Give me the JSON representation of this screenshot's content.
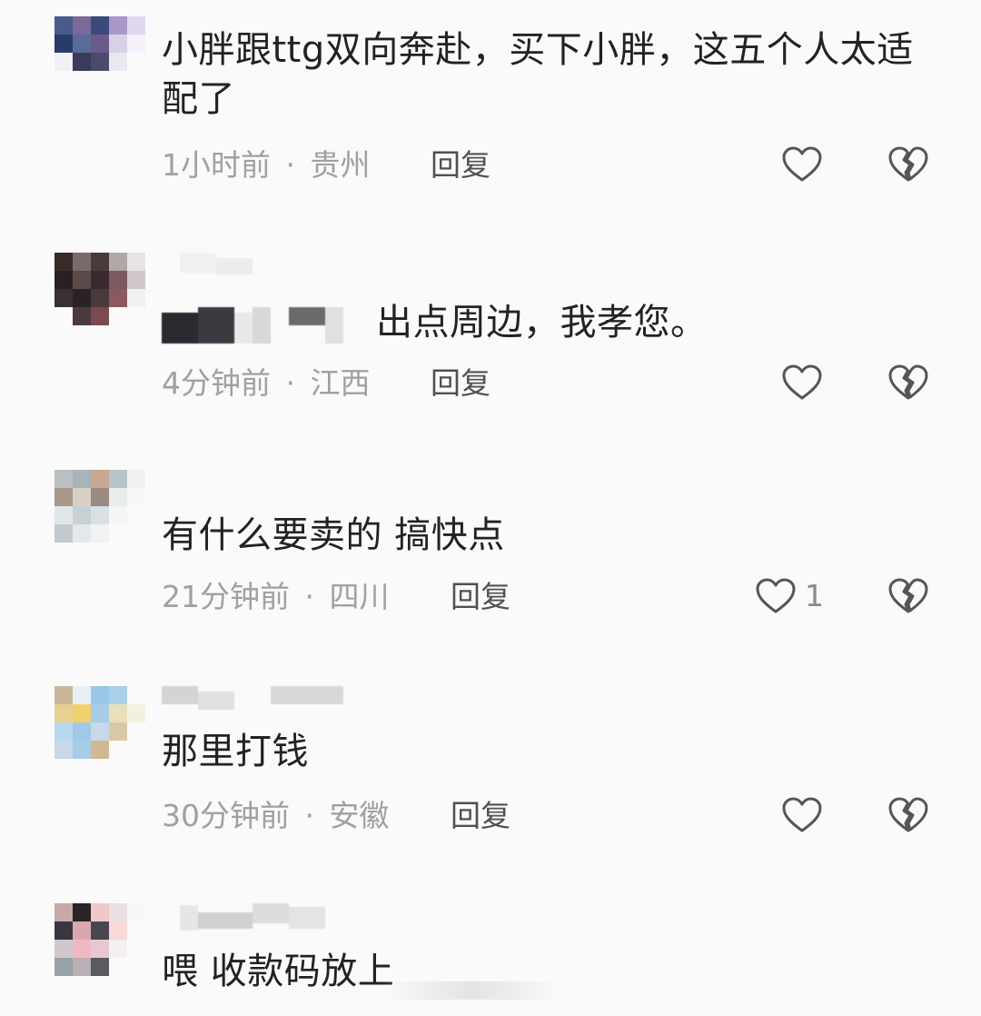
{
  "comments": [
    {
      "text": "小胖跟ttg双向奔赴，买下小胖，这五个人太适配了",
      "time": "1小时前",
      "location": "贵州",
      "reply_label": "回复",
      "likes": "",
      "avatar_colors": [
        "#4a5a8a",
        "#7a6a9a",
        "#3a4a7a",
        "#a898c8",
        "#e0d8f0",
        "#2a3a6a",
        "#5a6a9a",
        "#6a5a8a",
        "#d8d0e8",
        "#f5f0fa",
        "#f0f0f5",
        "#3a3a5a",
        "#4a4a6a",
        "#e8e8ee",
        "#fafafa",
        "#fafafa",
        "#fafafa",
        "#fafafa",
        "#fafafa",
        "#fafafa"
      ]
    },
    {
      "text": "出点周边，我孝您。",
      "time": "4分钟前",
      "location": "江西",
      "reply_label": "回复",
      "likes": "",
      "avatar_colors": [
        "#3a2a2a",
        "#7a6a6a",
        "#4a3a3a",
        "#b0a8a8",
        "#e8e4e4",
        "#2a2024",
        "#5a4a4a",
        "#3a2a30",
        "#7a5a60",
        "#d0c8c8",
        "#3a3034",
        "#2a2226",
        "#4a3a3e",
        "#8a5a60",
        "#f0f0f0",
        "#fafafa",
        "#4a3a3e",
        "#7a4a50",
        "#fafafa",
        "#fafafa"
      ]
    },
    {
      "text": "有什么要卖的 搞快点",
      "time": "21分钟前",
      "location": "四川",
      "reply_label": "回复",
      "likes": "1",
      "avatar_colors": [
        "#b8c0c4",
        "#a8b4b8",
        "#c8a890",
        "#b8c4c8",
        "#f0f2f2",
        "#a89888",
        "#d8d0c4",
        "#9a8a80",
        "#e8ecec",
        "#f8f8f8",
        "#e0e6e8",
        "#c8d0d4",
        "#d8e0e4",
        "#f4f6f6",
        "#fafafa",
        "#c0cace",
        "#e4e8ea",
        "#f0f2f4",
        "#fafafa",
        "#fafafa"
      ]
    },
    {
      "text": "那里打钱",
      "time": "30分钟前",
      "location": "安徽",
      "reply_label": "回复",
      "likes": "",
      "avatar_colors": [
        "#c8b898",
        "#e8f0f4",
        "#98c8e8",
        "#a8d0e8",
        "#f8fafc",
        "#e8d090",
        "#f0d070",
        "#a8cce8",
        "#e8e0b8",
        "#f4f0e0",
        "#b8d8f0",
        "#a0c8e8",
        "#c8d8e8",
        "#d8c8a8",
        "#fafafa",
        "#c8d8e8",
        "#a8cce8",
        "#d0b890",
        "#fafafa",
        "#fafafa"
      ]
    },
    {
      "text": "喂 收款码放上",
      "time": "",
      "location": "",
      "reply_label": "",
      "likes": "",
      "avatar_colors": [
        "#c8a8a8",
        "#2a2428",
        "#f0c8c8",
        "#e8e0e0",
        "#f8f8f8",
        "#3a3640",
        "#d8a8b0",
        "#4a4650",
        "#f8d8d8",
        "#fafafa",
        "#d0c8cc",
        "#f0b8c0",
        "#e8c8d0",
        "#f4f0f2",
        "#fafafa",
        "#98a0a8",
        "#b8b0b4",
        "#5a5a60",
        "#fafafa",
        "#fafafa"
      ]
    }
  ],
  "separator": "·",
  "colors": {
    "text": "#222222",
    "meta": "#a0a0a0",
    "reply": "#505050",
    "icon": "#555555"
  },
  "icons": {
    "like": "heart-outline-icon",
    "dislike": "broken-heart-icon"
  }
}
